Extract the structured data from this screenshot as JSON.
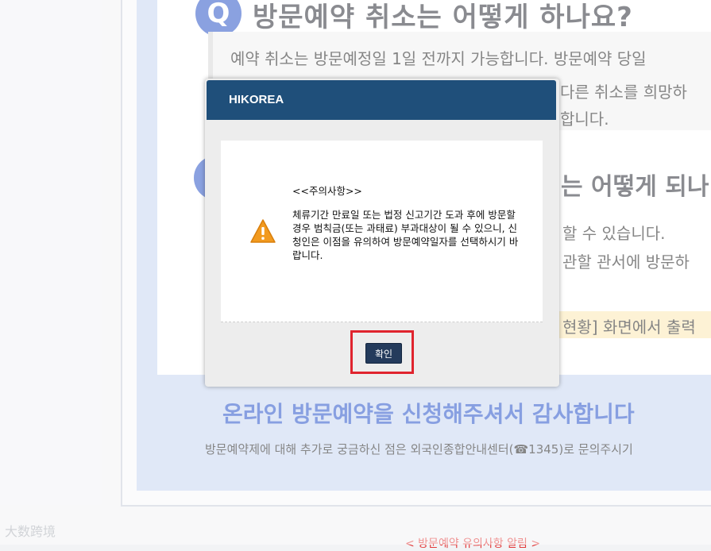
{
  "background": {
    "q_badge": "Q",
    "heading": "방문예약 취소는 어떻게 하나요?",
    "lines": [
      "예약 취소는 방문예정일 1일 전까지 가능합니다. 방문예약 당일",
      "다른 취소를 희망하",
      "합니다."
    ],
    "heading2": "는 어떻게 되나",
    "lines2": [
      "할 수 있습니다.",
      "관할 관서에 방문하"
    ],
    "highlight_text": "현황] 화면에서 출력",
    "blue_title": "온라인 방문예약을 신청해주셔서 감사합니다",
    "subtitle": "방문예약제에 대해 추가로 궁금하신 점은 외국인종합안내센터(☎1345)로 문의주시기",
    "bottom_notice": "< 방문예약 유의사항 알림 >",
    "watermark": "大数跨境"
  },
  "modal": {
    "title": "HIKOREA",
    "notice_title": "<<주의사항>>",
    "notice_text": "체류기간 만료일 또는 법정 신고기간 도과 후에 방문할 경우 범칙금(또는 과태료) 부과대상이 될 수 있으니, 신청인은 이점을 유의하여 방문예약일자를 선택하시기 바랍니다.",
    "ok_label": "확인",
    "icon": "warning-icon"
  },
  "colors": {
    "header": "#1f4f7a",
    "button": "#243b5c",
    "highlight_frame": "#e0242e",
    "accent_blue": "#2650c9",
    "warning": "#f29a1f"
  }
}
